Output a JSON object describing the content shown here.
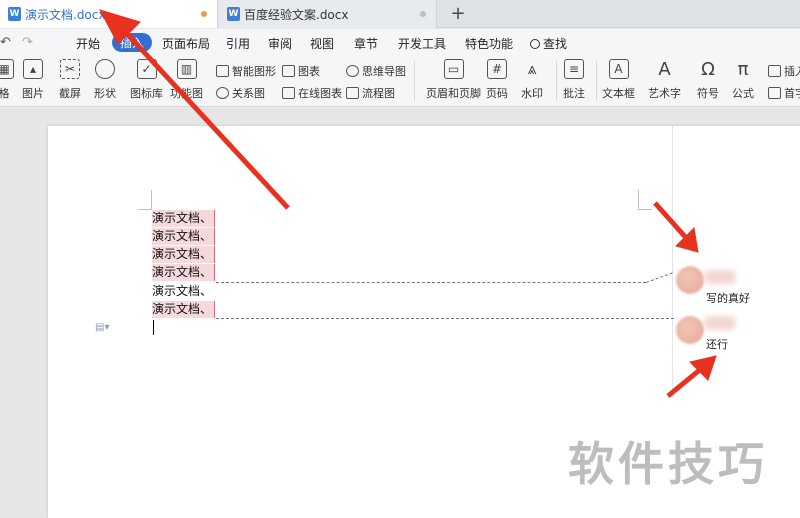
{
  "tabs": [
    {
      "label": "演示文档.docx",
      "icon": "W",
      "active": true,
      "dot_color": "#e5a04e"
    },
    {
      "label": "百度经验文案.docx",
      "icon": "W",
      "active": false,
      "dot_color": "#b9c0c8"
    }
  ],
  "new_tab_label": "+",
  "menu": {
    "items": [
      "开始",
      "插入",
      "页面布局",
      "引用",
      "审阅",
      "视图",
      "章节",
      "开发工具",
      "特色功能"
    ],
    "active": "插入",
    "search_label": "查找"
  },
  "ribbon": {
    "large_buttons": [
      "图片",
      "截屏",
      "形状",
      "图标库",
      "功能图",
      "页眉和页脚",
      "页码",
      "水印",
      "批注",
      "文本框",
      "艺术字",
      "符号",
      "公式",
      "插入"
    ],
    "small_buttons": [
      "智能图形",
      "图表",
      "思维导图",
      "关系图",
      "在线图表",
      "流程图"
    ],
    "partial_left_label": "格",
    "partial_right_label": "首字"
  },
  "document": {
    "lines": [
      {
        "text": "演示文档、",
        "highlight": true
      },
      {
        "text": "演示文档、",
        "highlight": true
      },
      {
        "text": "演示文档、",
        "highlight": true
      },
      {
        "text": "演示文档、",
        "highlight": true
      },
      {
        "text": "演示文档、",
        "highlight": false
      },
      {
        "text": "演示文档、",
        "highlight": true
      }
    ]
  },
  "comments": [
    {
      "text": "写的真好"
    },
    {
      "text": "还行"
    }
  ],
  "watermark": "软件技巧",
  "colors": {
    "accent": "#2f6fd6",
    "highlight": "#f6d9dc",
    "arrow": "#e8321f"
  }
}
